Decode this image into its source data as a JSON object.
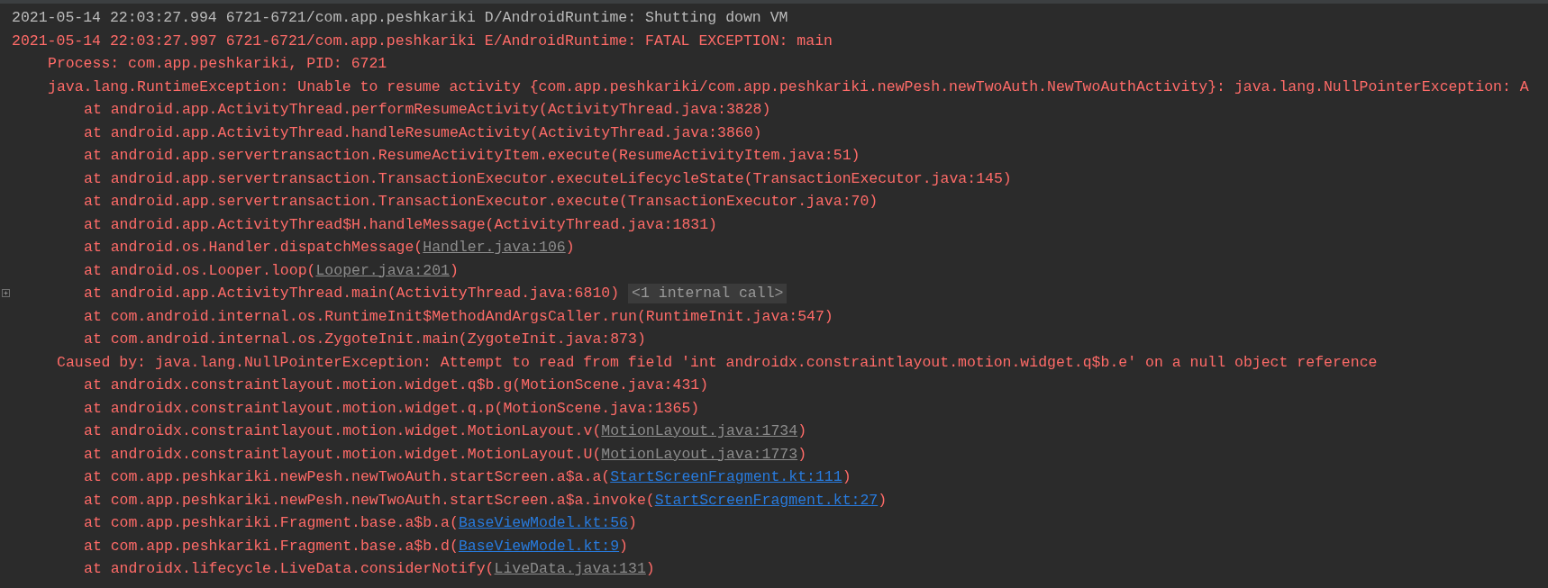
{
  "log_lines": [
    {
      "kind": "debug-header",
      "parts": [
        {
          "kind": "text",
          "text": "2021-05-14 22:03:27.994 6721-6721/com.app.peshkariki D/AndroidRuntime: Shutting down VM"
        }
      ]
    },
    {
      "kind": "error-header",
      "parts": [
        {
          "kind": "text",
          "text": "2021-05-14 22:03:27.997 6721-6721/com.app.peshkariki E/AndroidRuntime: FATAL EXCEPTION: main"
        }
      ]
    },
    {
      "kind": "detail",
      "parts": [
        {
          "kind": "text",
          "text": "Process: com.app.peshkariki, PID: 6721"
        }
      ]
    },
    {
      "kind": "detail",
      "parts": [
        {
          "kind": "text",
          "text": "java.lang.RuntimeException: Unable to resume activity {com.app.peshkariki/com.app.peshkariki.newPesh.newTwoAuth.NewTwoAuthActivity}: java.lang.NullPointerException: A"
        }
      ]
    },
    {
      "kind": "frame",
      "parts": [
        {
          "kind": "text",
          "text": "at android.app.ActivityThread.performResumeActivity(ActivityThread.java:3828)"
        }
      ]
    },
    {
      "kind": "frame",
      "parts": [
        {
          "kind": "text",
          "text": "at android.app.ActivityThread.handleResumeActivity(ActivityThread.java:3860)"
        }
      ]
    },
    {
      "kind": "frame",
      "parts": [
        {
          "kind": "text",
          "text": "at android.app.servertransaction.ResumeActivityItem.execute(ResumeActivityItem.java:51)"
        }
      ]
    },
    {
      "kind": "frame",
      "parts": [
        {
          "kind": "text",
          "text": "at android.app.servertransaction.TransactionExecutor.executeLifecycleState(TransactionExecutor.java:145)"
        }
      ]
    },
    {
      "kind": "frame",
      "parts": [
        {
          "kind": "text",
          "text": "at android.app.servertransaction.TransactionExecutor.execute(TransactionExecutor.java:70)"
        }
      ]
    },
    {
      "kind": "frame",
      "parts": [
        {
          "kind": "text",
          "text": "at android.app.ActivityThread$H.handleMessage(ActivityThread.java:1831)"
        }
      ]
    },
    {
      "kind": "frame",
      "parts": [
        {
          "kind": "text",
          "text": "at android.os.Handler.dispatchMessage("
        },
        {
          "kind": "library-link",
          "text": "Handler.java:106"
        },
        {
          "kind": "text",
          "text": ")"
        }
      ]
    },
    {
      "kind": "frame",
      "parts": [
        {
          "kind": "text",
          "text": "at android.os.Looper.loop("
        },
        {
          "kind": "library-link",
          "text": "Looper.java:201"
        },
        {
          "kind": "text",
          "text": ")"
        }
      ]
    },
    {
      "kind": "frame",
      "parts": [
        {
          "kind": "text",
          "text": "at android.app.ActivityThread.main(ActivityThread.java:6810)"
        },
        {
          "kind": "folded",
          "text": "<1 internal call>"
        }
      ]
    },
    {
      "kind": "frame",
      "parts": [
        {
          "kind": "text",
          "text": "at com.android.internal.os.RuntimeInit$MethodAndArgsCaller.run(RuntimeInit.java:547)"
        }
      ]
    },
    {
      "kind": "frame",
      "parts": [
        {
          "kind": "text",
          "text": "at com.android.internal.os.ZygoteInit.main(ZygoteInit.java:873)"
        }
      ]
    },
    {
      "kind": "cause",
      "parts": [
        {
          "kind": "text",
          "text": "Caused by: java.lang.NullPointerException: Attempt to read from field 'int androidx.constraintlayout.motion.widget.q$b.e' on a null object reference"
        }
      ]
    },
    {
      "kind": "frame",
      "parts": [
        {
          "kind": "text",
          "text": "at androidx.constraintlayout.motion.widget.q$b.g(MotionScene.java:431)"
        }
      ]
    },
    {
      "kind": "frame",
      "parts": [
        {
          "kind": "text",
          "text": "at androidx.constraintlayout.motion.widget.q.p(MotionScene.java:1365)"
        }
      ]
    },
    {
      "kind": "frame",
      "parts": [
        {
          "kind": "text",
          "text": "at androidx.constraintlayout.motion.widget.MotionLayout.v("
        },
        {
          "kind": "library-link",
          "text": "MotionLayout.java:1734"
        },
        {
          "kind": "text",
          "text": ")"
        }
      ]
    },
    {
      "kind": "frame",
      "parts": [
        {
          "kind": "text",
          "text": "at androidx.constraintlayout.motion.widget.MotionLayout.U("
        },
        {
          "kind": "library-link",
          "text": "MotionLayout.java:1773"
        },
        {
          "kind": "text",
          "text": ")"
        }
      ]
    },
    {
      "kind": "frame",
      "parts": [
        {
          "kind": "text",
          "text": "at com.app.peshkariki.newPesh.newTwoAuth.startScreen.a$a.a("
        },
        {
          "kind": "source-link",
          "text": "StartScreenFragment.kt:111"
        },
        {
          "kind": "text",
          "text": ")"
        }
      ]
    },
    {
      "kind": "frame",
      "parts": [
        {
          "kind": "text",
          "text": "at com.app.peshkariki.newPesh.newTwoAuth.startScreen.a$a.invoke("
        },
        {
          "kind": "source-link",
          "text": "StartScreenFragment.kt:27"
        },
        {
          "kind": "text",
          "text": ")"
        }
      ]
    },
    {
      "kind": "frame",
      "parts": [
        {
          "kind": "text",
          "text": "at com.app.peshkariki.Fragment.base.a$b.a("
        },
        {
          "kind": "source-link",
          "text": "BaseViewModel.kt:56"
        },
        {
          "kind": "text",
          "text": ")"
        }
      ]
    },
    {
      "kind": "frame",
      "parts": [
        {
          "kind": "text",
          "text": "at com.app.peshkariki.Fragment.base.a$b.d("
        },
        {
          "kind": "source-link",
          "text": "BaseViewModel.kt:9"
        },
        {
          "kind": "text",
          "text": ")"
        }
      ]
    },
    {
      "kind": "frame",
      "parts": [
        {
          "kind": "text",
          "text": "at androidx.lifecycle.LiveData.considerNotify("
        },
        {
          "kind": "library-link",
          "text": "LiveData.java:131"
        },
        {
          "kind": "text",
          "text": ")"
        }
      ]
    }
  ]
}
